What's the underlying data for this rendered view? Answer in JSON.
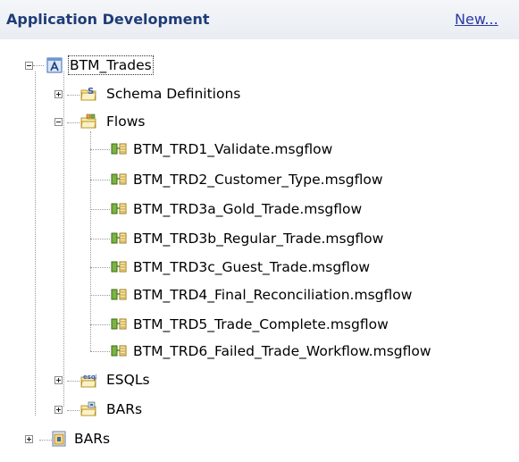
{
  "header": {
    "title": "Application Development",
    "new_link": "New..."
  },
  "tree": {
    "app": {
      "label": "BTM_Trades",
      "icon": "application-icon",
      "expanded": true,
      "children": {
        "schema": {
          "label": "Schema Definitions",
          "icon": "schema-folder-icon",
          "expanded": false
        },
        "flows": {
          "label": "Flows",
          "icon": "flows-folder-icon",
          "expanded": true,
          "items": [
            "BTM_TRD1_Validate.msgflow",
            "BTM_TRD2_Customer_Type.msgflow",
            "BTM_TRD3a_Gold_Trade.msgflow",
            "BTM_TRD3b_Regular_Trade.msgflow",
            "BTM_TRD3c_Guest_Trade.msgflow",
            "BTM_TRD4_Final_Reconciliation.msgflow",
            "BTM_TRD5_Trade_Complete.msgflow",
            "BTM_TRD6_Failed_Trade_Workflow.msgflow"
          ]
        },
        "esqls": {
          "label": "ESQLs",
          "icon": "esql-folder-icon",
          "expanded": false
        },
        "bars": {
          "label": "BARs",
          "icon": "bars-folder-icon",
          "expanded": false
        }
      }
    },
    "bars_root": {
      "label": "BARs",
      "icon": "bar-root-icon",
      "expanded": false
    }
  }
}
